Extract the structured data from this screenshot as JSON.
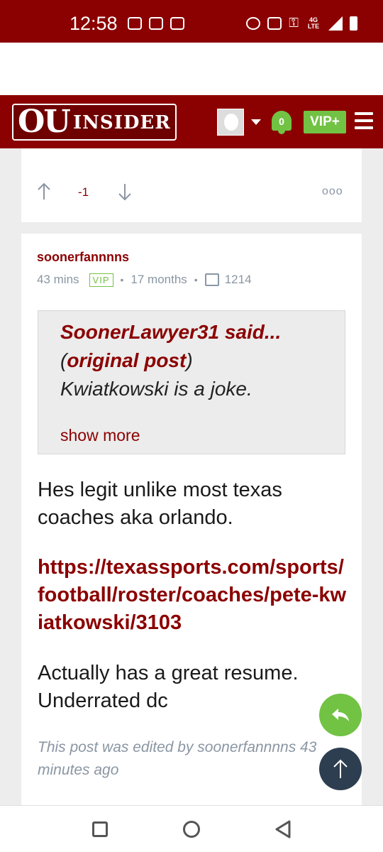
{
  "status_bar": {
    "time": "12:58",
    "network": "4G LTE"
  },
  "header": {
    "logo_ou": "OU",
    "logo_insider": "INSIDER",
    "notification_count": "0",
    "vip_button": "VIP+",
    "brand_color": "#8b0000",
    "accent_color": "#72c244"
  },
  "prev_post": {
    "vote_count": "-1",
    "more_label": "ooo"
  },
  "post": {
    "author": "soonerfannnns",
    "time_ago": "43 mins",
    "badge": "VIP",
    "member_age": "17 months",
    "post_count": "1214",
    "quote": {
      "who": "SoonerLawyer31 said...",
      "open_paren": "(",
      "original_link": "original post",
      "close_paren": ")",
      "text": "Kwiatkowski is a joke.",
      "show_more": "show more"
    },
    "paragraph1": "Hes legit unlike most texas coaches aka orlando.",
    "link": "https://texassports.com/sports/football/roster/coaches/pete-kwiatkowski/3103",
    "paragraph2": "Actually has a great resume. Underrated dc",
    "edited_note": "This post was edited by soonerfannnns 43 minutes ago"
  }
}
